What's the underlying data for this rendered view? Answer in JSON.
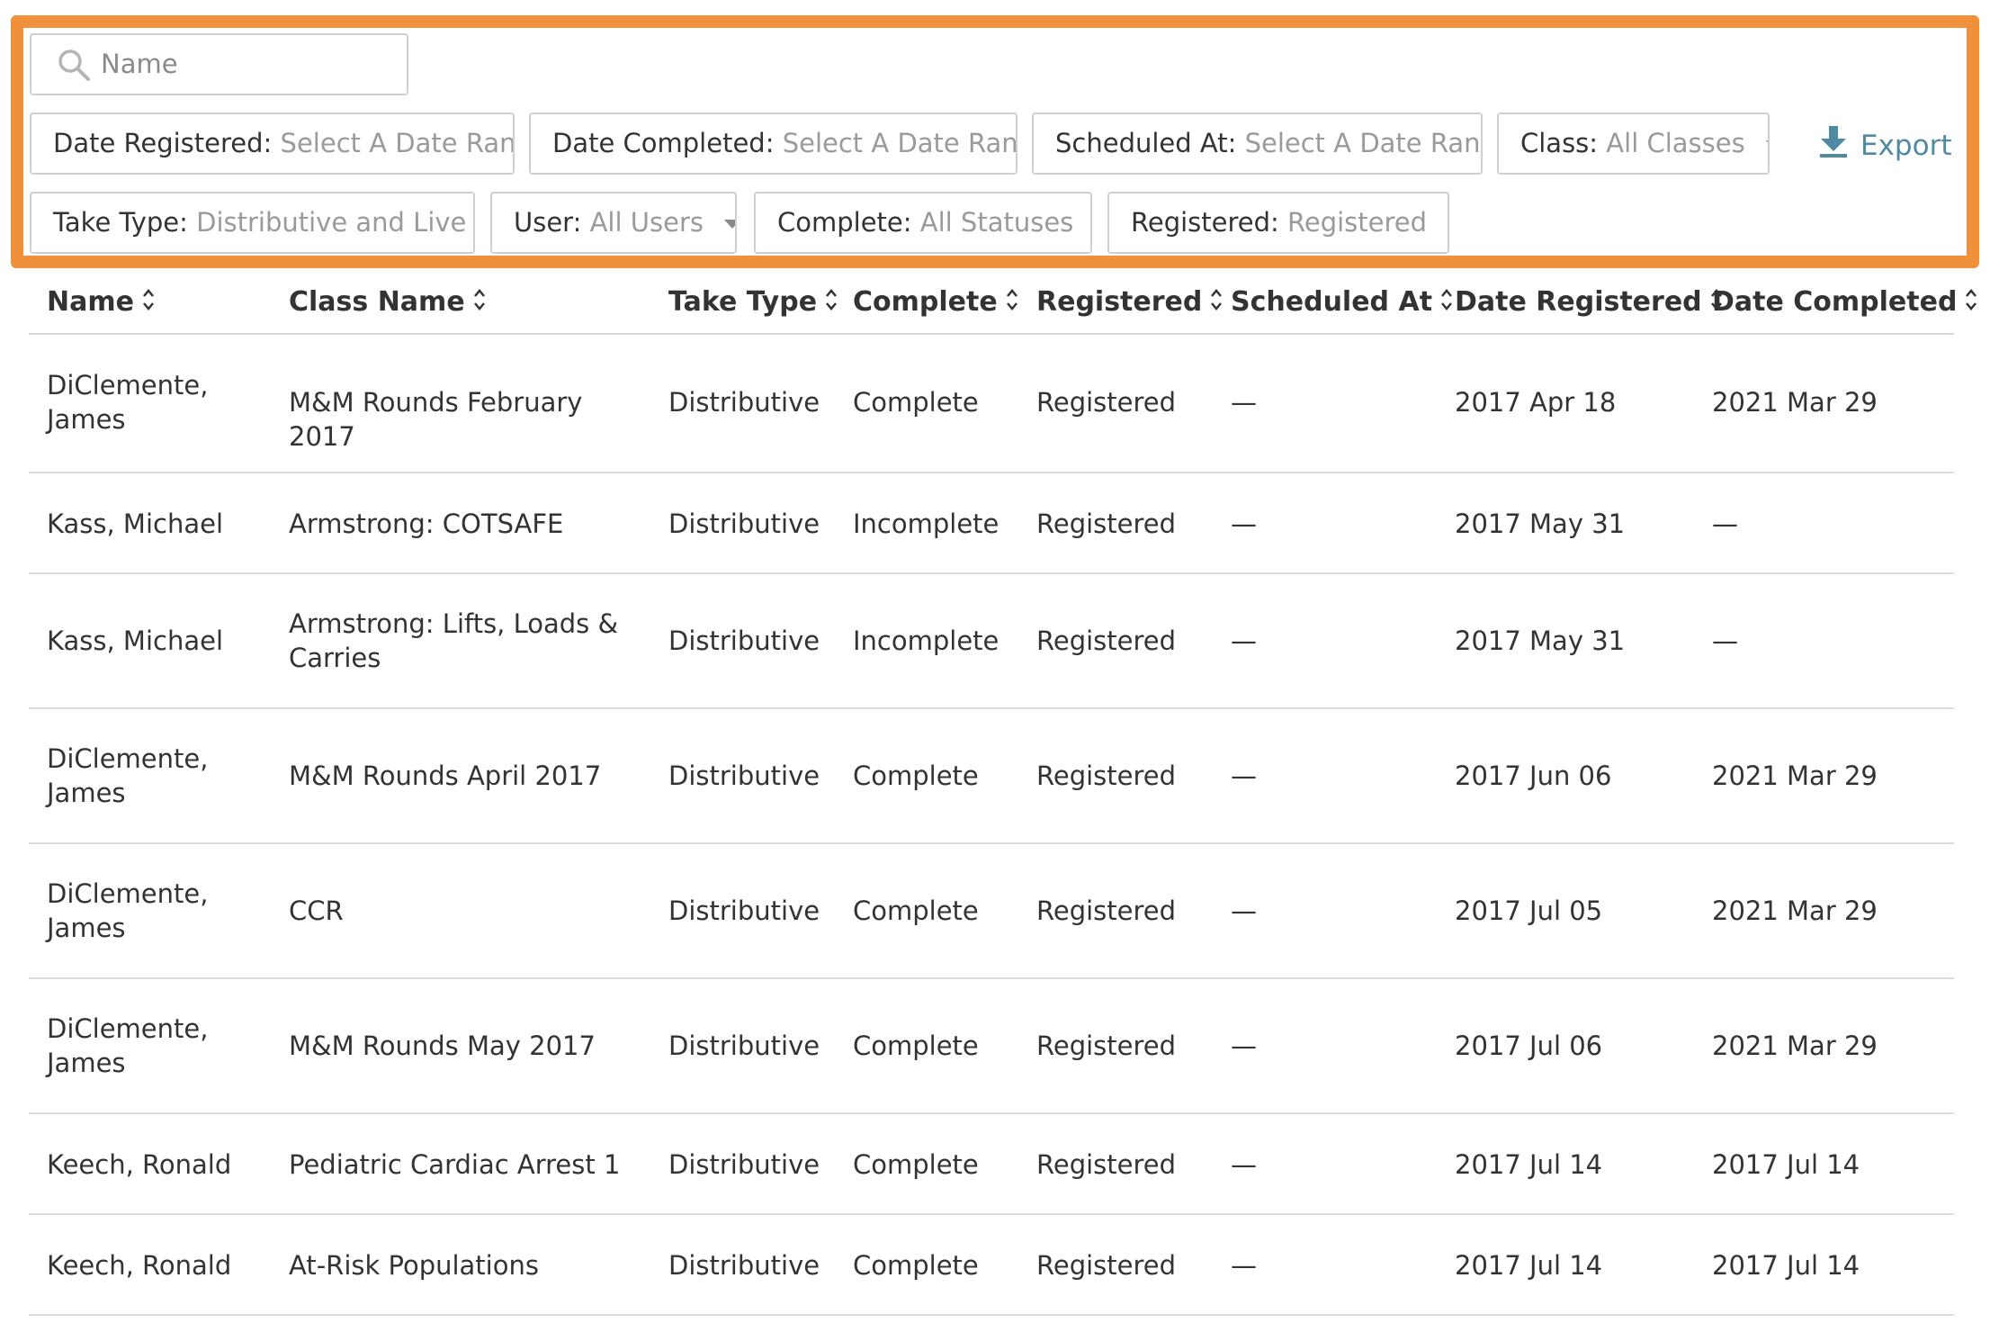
{
  "search": {
    "placeholder": "Name"
  },
  "filters": [
    {
      "key": "Date Registered:",
      "value": "Select A Date Range"
    },
    {
      "key": "Date Completed:",
      "value": "Select A Date Range"
    },
    {
      "key": "Scheduled At:",
      "value": "Select A Date Range"
    },
    {
      "key": "Class:",
      "value": "All Classes"
    },
    {
      "key": "Take Type:",
      "value": "Distributive and Live"
    },
    {
      "key": "User:",
      "value": "All Users"
    },
    {
      "key": "Complete:",
      "value": "All Statuses"
    },
    {
      "key": "Registered:",
      "value": "Registered"
    }
  ],
  "export_label": "Export",
  "columns": [
    "Name",
    "Class Name",
    "Take Type",
    "Complete",
    "Registered",
    "Scheduled At",
    "Date Registered",
    "Date Completed"
  ],
  "rows": [
    [
      "DiClemente, James",
      "M&M Rounds February 2017",
      "Distributive",
      "Complete",
      "Registered",
      "—",
      "2017 Apr 18",
      "2021 Mar 29"
    ],
    [
      "Kass, Michael",
      "Armstrong: COTSAFE",
      "Distributive",
      "Incomplete",
      "Registered",
      "—",
      "2017 May 31",
      "—"
    ],
    [
      "Kass, Michael",
      "Armstrong: Lifts, Loads & Carries",
      "Distributive",
      "Incomplete",
      "Registered",
      "—",
      "2017 May 31",
      "—"
    ],
    [
      "DiClemente, James",
      "M&M Rounds April 2017",
      "Distributive",
      "Complete",
      "Registered",
      "—",
      "2017 Jun 06",
      "2021 Mar 29"
    ],
    [
      "DiClemente, James",
      "CCR",
      "Distributive",
      "Complete",
      "Registered",
      "—",
      "2017 Jul 05",
      "2021 Mar 29"
    ],
    [
      "DiClemente, James",
      "M&M Rounds May 2017",
      "Distributive",
      "Complete",
      "Registered",
      "—",
      "2017 Jul 06",
      "2021 Mar 29"
    ],
    [
      "Keech, Ronald",
      "Pediatric Cardiac Arrest 1",
      "Distributive",
      "Complete",
      "Registered",
      "—",
      "2017 Jul 14",
      "2017 Jul 14"
    ],
    [
      "Keech, Ronald",
      "At-Risk Populations",
      "Distributive",
      "Complete",
      "Registered",
      "—",
      "2017 Jul 14",
      "2017 Jul 14"
    ]
  ],
  "colors": {
    "highlight": "#f0903a",
    "export": "#4f8aa2"
  }
}
